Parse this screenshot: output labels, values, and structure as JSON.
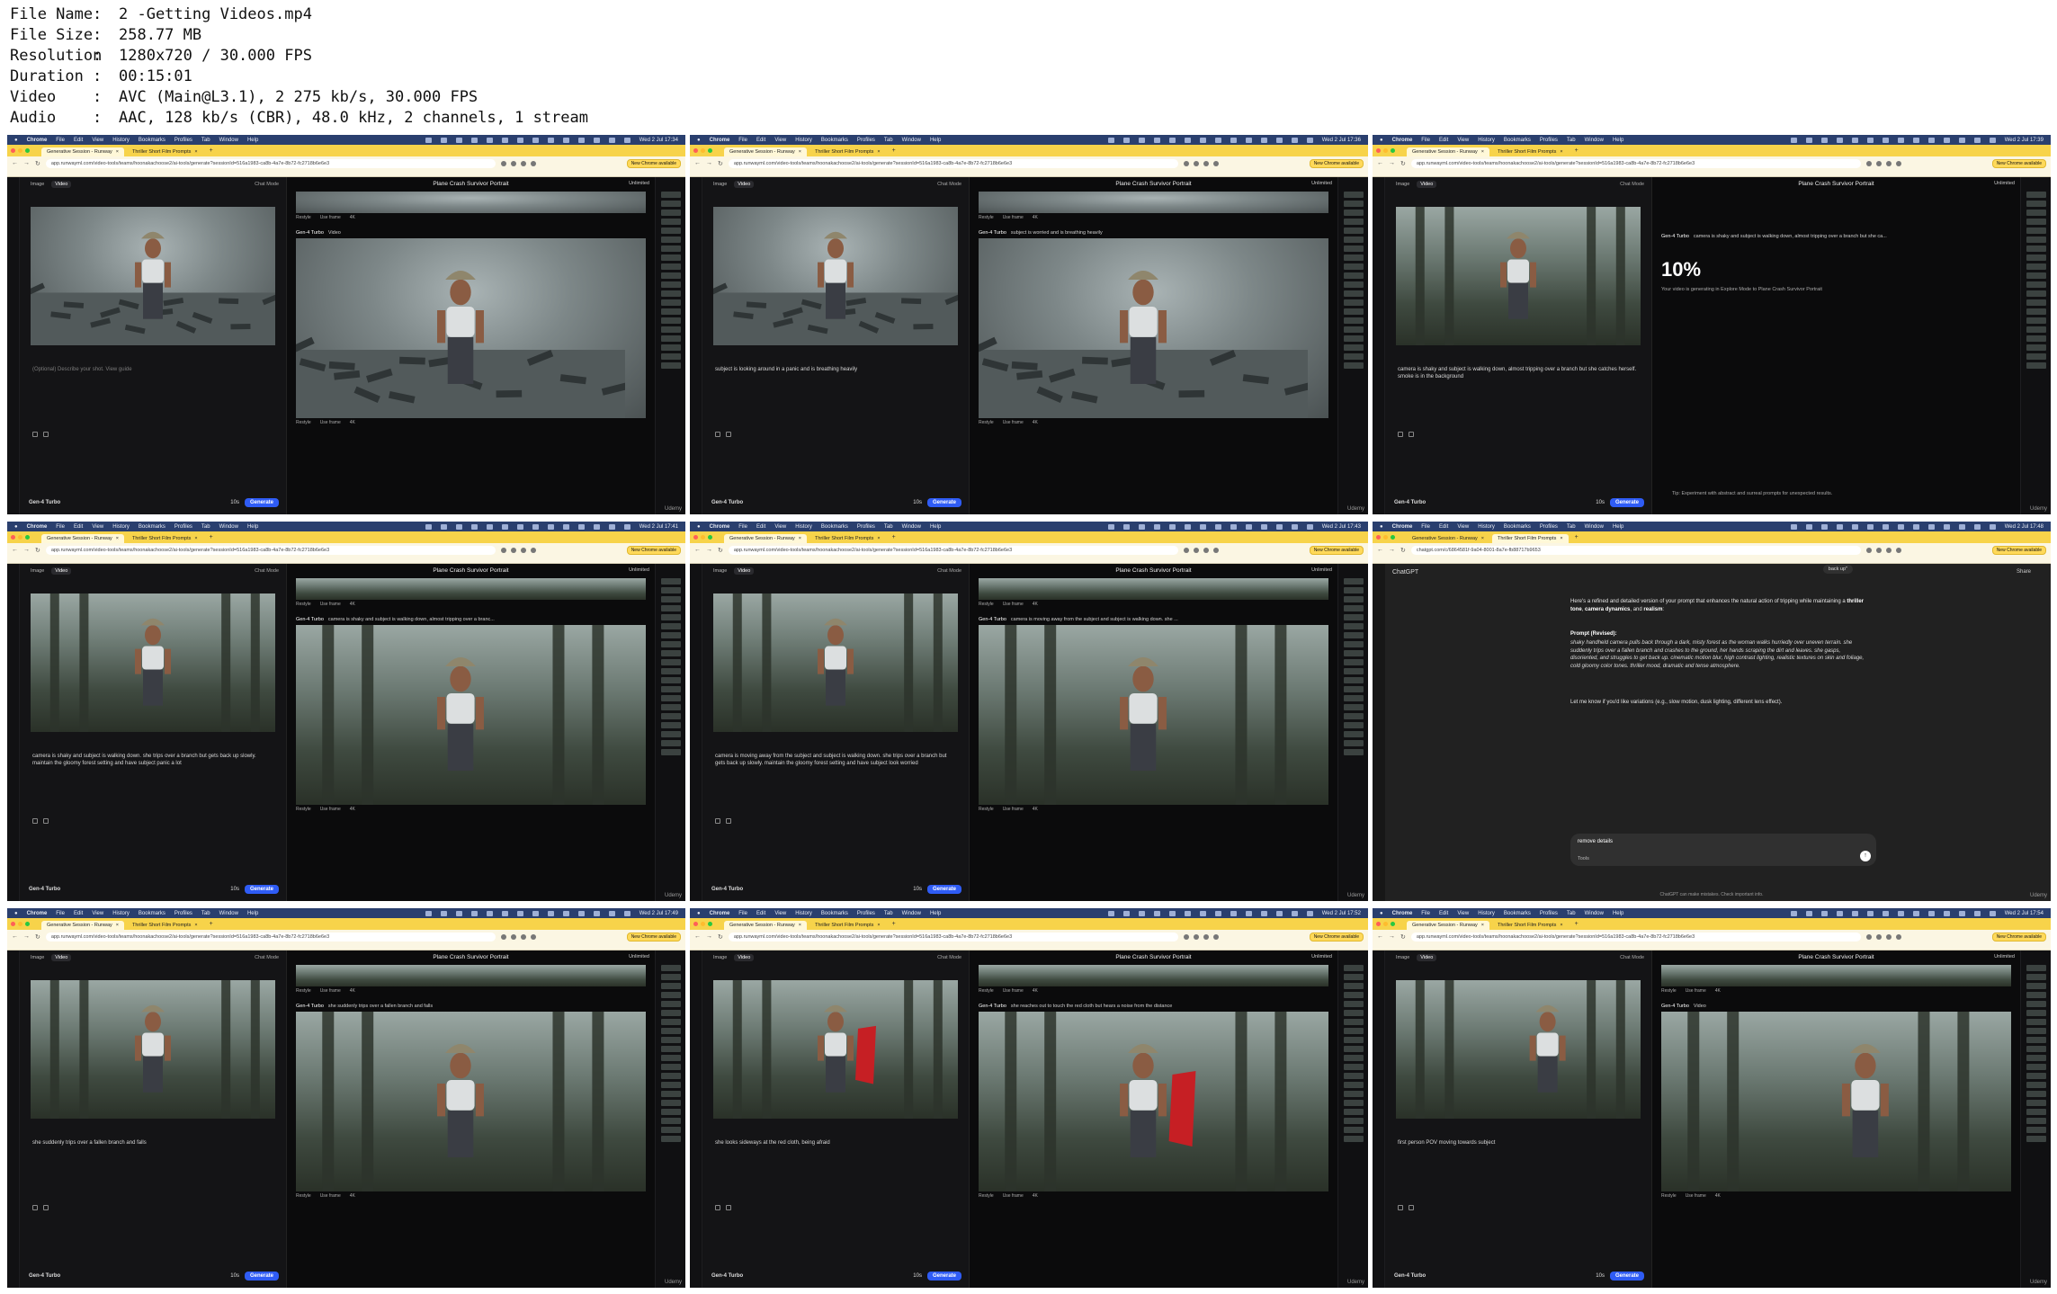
{
  "media_info": [
    {
      "key": "File Name",
      "value": "2 -Getting Videos.mp4"
    },
    {
      "key": "File Size",
      "value": "258.77 MB"
    },
    {
      "key": "Resolution",
      "value": "1280x720 / 30.000 FPS"
    },
    {
      "key": "Duration",
      "value": "00:15:01"
    },
    {
      "key": "Video",
      "value": "AVC (Main@L3.1), 2 275 kb/s, 30.000 FPS"
    },
    {
      "key": "Audio",
      "value": "AAC, 128 kb/s (CBR), 48.0 kHz, 2 channels, 1 stream"
    }
  ],
  "info_separator": ":",
  "browser": {
    "menu": [
      "Chrome",
      "File",
      "Edit",
      "View",
      "History",
      "Bookmarks",
      "Profiles",
      "Tab",
      "Window",
      "Help"
    ],
    "tab_runway": "Generative Session - Runway",
    "tab_prompts": "Thriller Short Film Prompts",
    "url_runway": "app.runwayml.com/video-tools/teams/hoonakachoose2/ai-tools/generate?sessionId=516a1983-ca8b-4a7e-8b72-fc2718b6e6e3",
    "url_chatgpt": "chatgpt.com/c/6864581f-9a04-8001-8a7e-fb88717b9653",
    "new_chrome": "New Chrome available"
  },
  "runway": {
    "tab_image": "Image",
    "tab_video": "Video",
    "chat_mode": "Chat Mode",
    "title": "Plane Crash Survivor Portrait",
    "unlimited": "Unlimited",
    "model": "Gen-4 Turbo",
    "duration": "10s",
    "generate": "Generate",
    "restyle": "Restyle",
    "use_frame": "Use frame",
    "quality": "4K",
    "watermark": "Udemy",
    "placeholder": "(Optional) Describe your shot. View guide",
    "progress": "10%",
    "progress_note": "Your video is generating in Explore Mode to Plane Crash Survivor Portrait",
    "tip": "Tip: Experiment with abstract and surreal prompts for unexpected results."
  },
  "thumbs": [
    {
      "clock": "Wed 2 Jul 17:34",
      "prompt": "(Optional) Describe your shot. View guide",
      "gen_label": "Video",
      "scene": "crash"
    },
    {
      "clock": "Wed 2 Jul 17:36",
      "prompt": "subject is looking around in a panic and is breathing heavily",
      "gen_label": "subject is worried and is breathing heavily",
      "gen_label_2": "subject is looking around in a panic and is breathing heavily",
      "scene": "crash-close"
    },
    {
      "clock": "Wed 2 Jul 17:39",
      "prompt": "camera is shaky and subject is walking down, almost tripping over a branch but she catches herself. smoke is in the background",
      "gen_label": "camera is shaky and subject is walking down, almost tripping over a branch but she ca...",
      "scene": "progress"
    },
    {
      "clock": "Wed 2 Jul 17:41",
      "prompt": "camera is shaky and subject is walking down. she trips over a branch but gets back up slowly. maintain the gloomy forest setting and have subject panic a lot",
      "gen_label": "camera is shaky and subject is walking down, almost tripping over a branc...",
      "scene": "forest"
    },
    {
      "clock": "Wed 2 Jul 17:43",
      "prompt": "camera is moving away from the subject and subject is walking down. she trips over a branch but gets back up slowly. maintain the gloomy forest setting and have subject look worried",
      "gen_label": "camera is moving away from the subject and subject is walking down. she ...",
      "scene": "forest"
    },
    {
      "clock": "Wed 2 Jul 17:48",
      "scene": "chatgpt"
    },
    {
      "clock": "Wed 2 Jul 17:49",
      "prompt": "she suddenly trips over a fallen branch and falls",
      "gen_label": "she suddenly trips over a fallen branch and falls",
      "scene": "forest"
    },
    {
      "clock": "Wed 2 Jul 17:52",
      "prompt": "she looks sideways at the red cloth, being afraid",
      "gen_label": "she reaches out to touch the red cloth but hears a noise from the distance",
      "scene": "red-cloth"
    },
    {
      "clock": "Wed 2 Jul 17:54",
      "prompt": "first person POV moving towards subject",
      "gen_label": "Video",
      "gen_label_2": "first person POV moving towards subject",
      "scene": "pov"
    }
  ],
  "chatgpt": {
    "brand": "ChatGPT",
    "share": "Share",
    "bubble": "back up\"",
    "intro_1": "Here's a refined and detailed version of your prompt that enhances the natural action of tripping while maintaining a ",
    "intro_bold_1": "thriller tone",
    "intro_mid": ", ",
    "intro_bold_2": "camera dynamics",
    "intro_end": ", and ",
    "intro_bold_3": "realism",
    "intro_colon": ":",
    "prompt_heading": "Prompt (Revised):",
    "prompt_text": "shaky handheld camera pulls back through a dark, misty forest as the woman walks hurriedly over uneven terrain. she suddenly trips over a fallen branch and crashes to the ground, her hands scraping the dirt and leaves. she gasps, disoriented, and struggles to get back up. cinematic motion blur, high contrast lighting, realistic textures on skin and foliage, cold gloomy color tones. thriller mood, dramatic and tense atmosphere.",
    "followup": "Let me know if you'd like variations (e.g., slow motion, dusk lighting, different lens effect).",
    "input": "remove details",
    "tools": "Tools",
    "footer": "ChatGPT can make mistakes. Check important info."
  },
  "colors": {
    "menubar": "#2a3f6e",
    "tabbar": "#f7d34a",
    "generate": "#2f5cf5"
  }
}
